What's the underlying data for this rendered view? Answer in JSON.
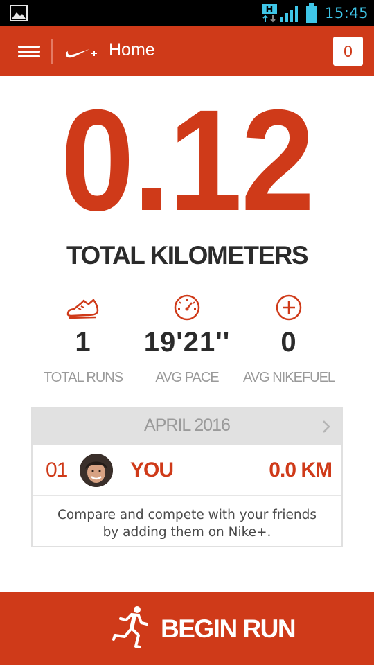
{
  "status_bar": {
    "time": "15:45",
    "network_label": "H",
    "icons": [
      "gallery-icon",
      "network-h-icon",
      "signal-icon",
      "battery-icon"
    ],
    "time_color": "#3fc6e8"
  },
  "app_bar": {
    "title": "Home",
    "notification_count": "0",
    "background": "#cf3a19",
    "icons": [
      "menu-icon",
      "nike-plus-logo"
    ]
  },
  "summary": {
    "total_distance": "0.12",
    "distance_label": "TOTAL KILOMETERS"
  },
  "stats": [
    {
      "value": "1",
      "label": "TOTAL RUNS",
      "icon": "shoe-icon"
    },
    {
      "value": "19'21''",
      "label": "AVG PACE",
      "icon": "speedometer-icon"
    },
    {
      "value": "0",
      "label": "AVG NIKEFUEL",
      "icon": "nikefuel-plus-icon"
    }
  ],
  "leaderboard": {
    "month": "APRIL 2016",
    "rows": [
      {
        "rank": "01",
        "name": "YOU",
        "distance": "0.0 KM"
      }
    ],
    "prompt_line1": "Compare and compete with your friends",
    "prompt_line2": "by adding them on Nike+."
  },
  "action": {
    "label": "BEGIN RUN",
    "icon": "runner-icon"
  },
  "colors": {
    "accent": "#cf3a19",
    "text_dark": "#2b2b2b",
    "text_muted": "#9a9a9a"
  }
}
